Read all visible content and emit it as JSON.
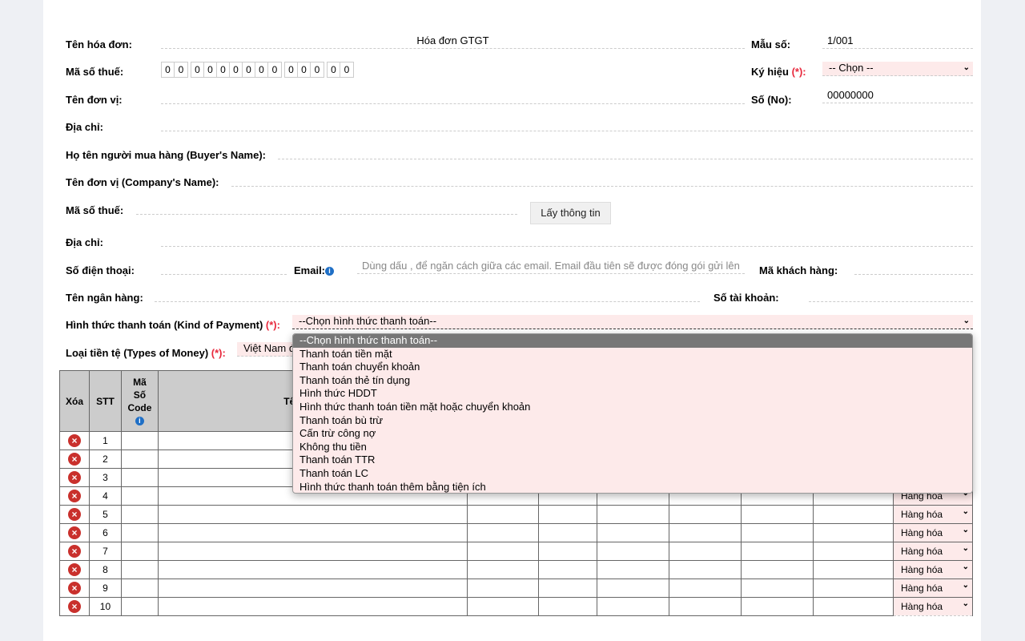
{
  "form": {
    "ten_hoa_don": {
      "label": "Tên hóa đơn:",
      "value": "Hóa đơn GTGT"
    },
    "mau_so": {
      "label": "Mẫu số:",
      "value": "1/001"
    },
    "ma_so_thue_seller": {
      "label": "Mã số thuế:",
      "digits": [
        [
          "0",
          "0"
        ],
        [
          "0",
          "0",
          "0",
          "0",
          "0",
          "0",
          "0"
        ],
        [
          "0",
          "0",
          "0"
        ],
        [
          "0",
          "0"
        ]
      ]
    },
    "ky_hieu": {
      "label": "Ký hiệu",
      "required": "(*):",
      "value": "-- Chọn --"
    },
    "ten_don_vi": {
      "label": "Tên đơn vị:"
    },
    "so_no": {
      "label": "Số (No):",
      "value": "00000000"
    },
    "dia_chi": {
      "label": "Địa chỉ:"
    },
    "buyer_name": {
      "label": "Họ tên người mua hàng (Buyer's Name):"
    },
    "company_name": {
      "label": "Tên đơn vị (Company's Name):"
    },
    "ma_so_thue_buyer": {
      "label": "Mã số thuế:"
    },
    "lay_thong_tin": "Lấy thông tin",
    "dia_chi_buyer": {
      "label": "Địa chỉ:"
    },
    "so_dien_thoai": {
      "label": "Số điện thoại:"
    },
    "email": {
      "label": "Email:",
      "placeholder": "Dùng dấu , để ngăn cách giữa các email. Email đầu tiên sẽ được đóng gói gửi lên"
    },
    "ma_khach_hang": {
      "label": "Mã khách hàng:"
    },
    "ten_ngan_hang": {
      "label": "Tên ngân hàng:"
    },
    "so_tai_khoan": {
      "label": "Số tài khoản:"
    },
    "payment": {
      "label": "Hình thức thanh toán (Kind of Payment)",
      "required": "(*):",
      "value": "--Chọn hình thức thanh toán--",
      "options": [
        "--Chọn hình thức thanh toán--",
        "Thanh toán tiền mặt",
        "Thanh toán chuyển khoản",
        "Thanh toán thẻ tín dụng",
        "Hình thức HDDT",
        "Hình thức thanh toán tiền mặt hoặc chuyển khoản",
        "Thanh toán bù trừ",
        "Cấn trừ công nợ",
        "Không thu tiền",
        "Thanh toán TTR",
        "Thanh toán LC",
        "Hình thức thanh toán thêm bằng tiện ích"
      ]
    },
    "currency": {
      "label": "Loại tiền tệ (Types of Money)",
      "required": "(*):",
      "value": "Việt Nam đ"
    }
  },
  "table": {
    "headers": {
      "xoa": "Xóa",
      "stt": "STT",
      "ma": "Mã Số Code",
      "ten": "Tên Sản Phẩ"
    },
    "rows": [
      "1",
      "2",
      "3",
      "4",
      "5",
      "6",
      "7",
      "8",
      "9",
      "10"
    ],
    "type_value": "Hàng hóa"
  },
  "colors": {
    "required": "#e8283c",
    "select_bg": "#fdeaea",
    "delete": "#c9302c"
  }
}
